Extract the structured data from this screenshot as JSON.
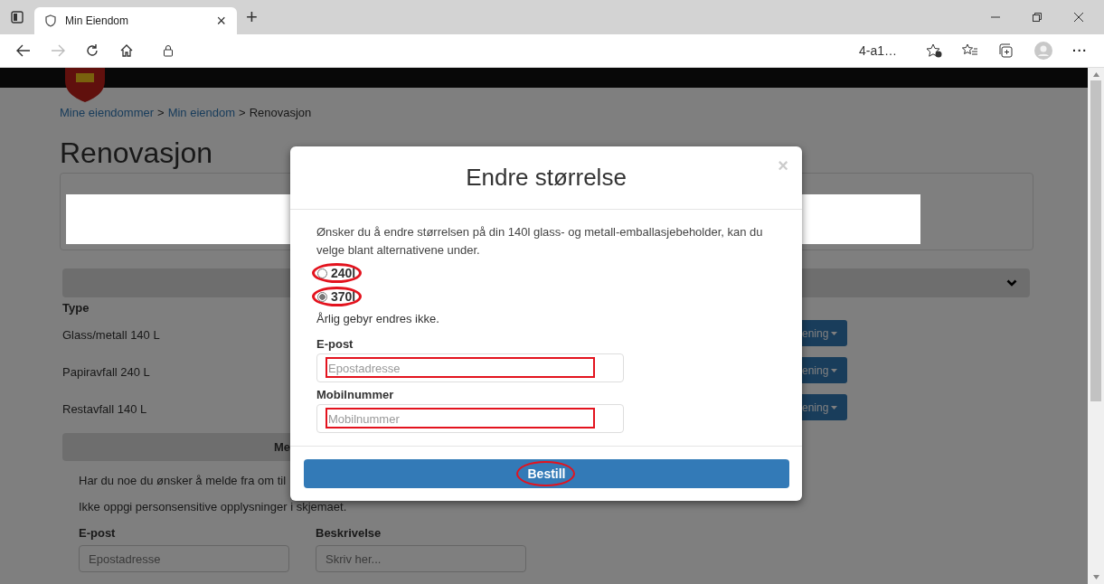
{
  "browser": {
    "tab_title": "Min Eiendom",
    "tab_close": "×",
    "new_tab": "+",
    "address": "4-a1…",
    "menu": "···"
  },
  "breadcrumb": [
    {
      "kind": "link",
      "text": "Mine eiendommer"
    },
    {
      "kind": "separator",
      "text": ">"
    },
    {
      "kind": "link",
      "text": "Min eiendom"
    },
    {
      "kind": "separator",
      "text": ">"
    },
    {
      "kind": "current",
      "text": "Renovasjon"
    }
  ],
  "page_title": "Renovasjon",
  "table": {
    "header": "Type",
    "rows": [
      {
        "type": "Glass/metall 140 L",
        "action": "ening"
      },
      {
        "type": "Papiravfall 240 L",
        "action": "ening"
      },
      {
        "type": "Restavfall 140 L",
        "action": "ening"
      }
    ]
  },
  "report_section": {
    "heading": "Me",
    "paragraphs": [
      "Har du noe du ønsker å melde fra om til",
      "Ikke oppgi personsensitive opplysninger i skjemaet."
    ],
    "fields": [
      {
        "label": "E-post",
        "placeholder": "Epostadresse"
      },
      {
        "label": "Beskrivelse",
        "placeholder": "Skriv her..."
      }
    ]
  },
  "modal": {
    "title": "Endre størrelse",
    "close": "×",
    "intro": "Ønsker du å endre størrelsen på din 140l glass- og metall-emballasjebeholder, kan du velge blant alternativene under.",
    "options": [
      {
        "label": "240l",
        "selected": false,
        "annotated": true
      },
      {
        "label": "370l",
        "selected": true,
        "annotated": true
      }
    ],
    "note": "Årlig gebyr endres ikke.",
    "fields": [
      {
        "label": "E-post",
        "placeholder": "Epostadresse",
        "annotated": true
      },
      {
        "label": "Mobilnummer",
        "placeholder": "Mobilnummer",
        "annotated": true
      }
    ],
    "submit": {
      "label": "Bestill",
      "annotated": true
    }
  }
}
